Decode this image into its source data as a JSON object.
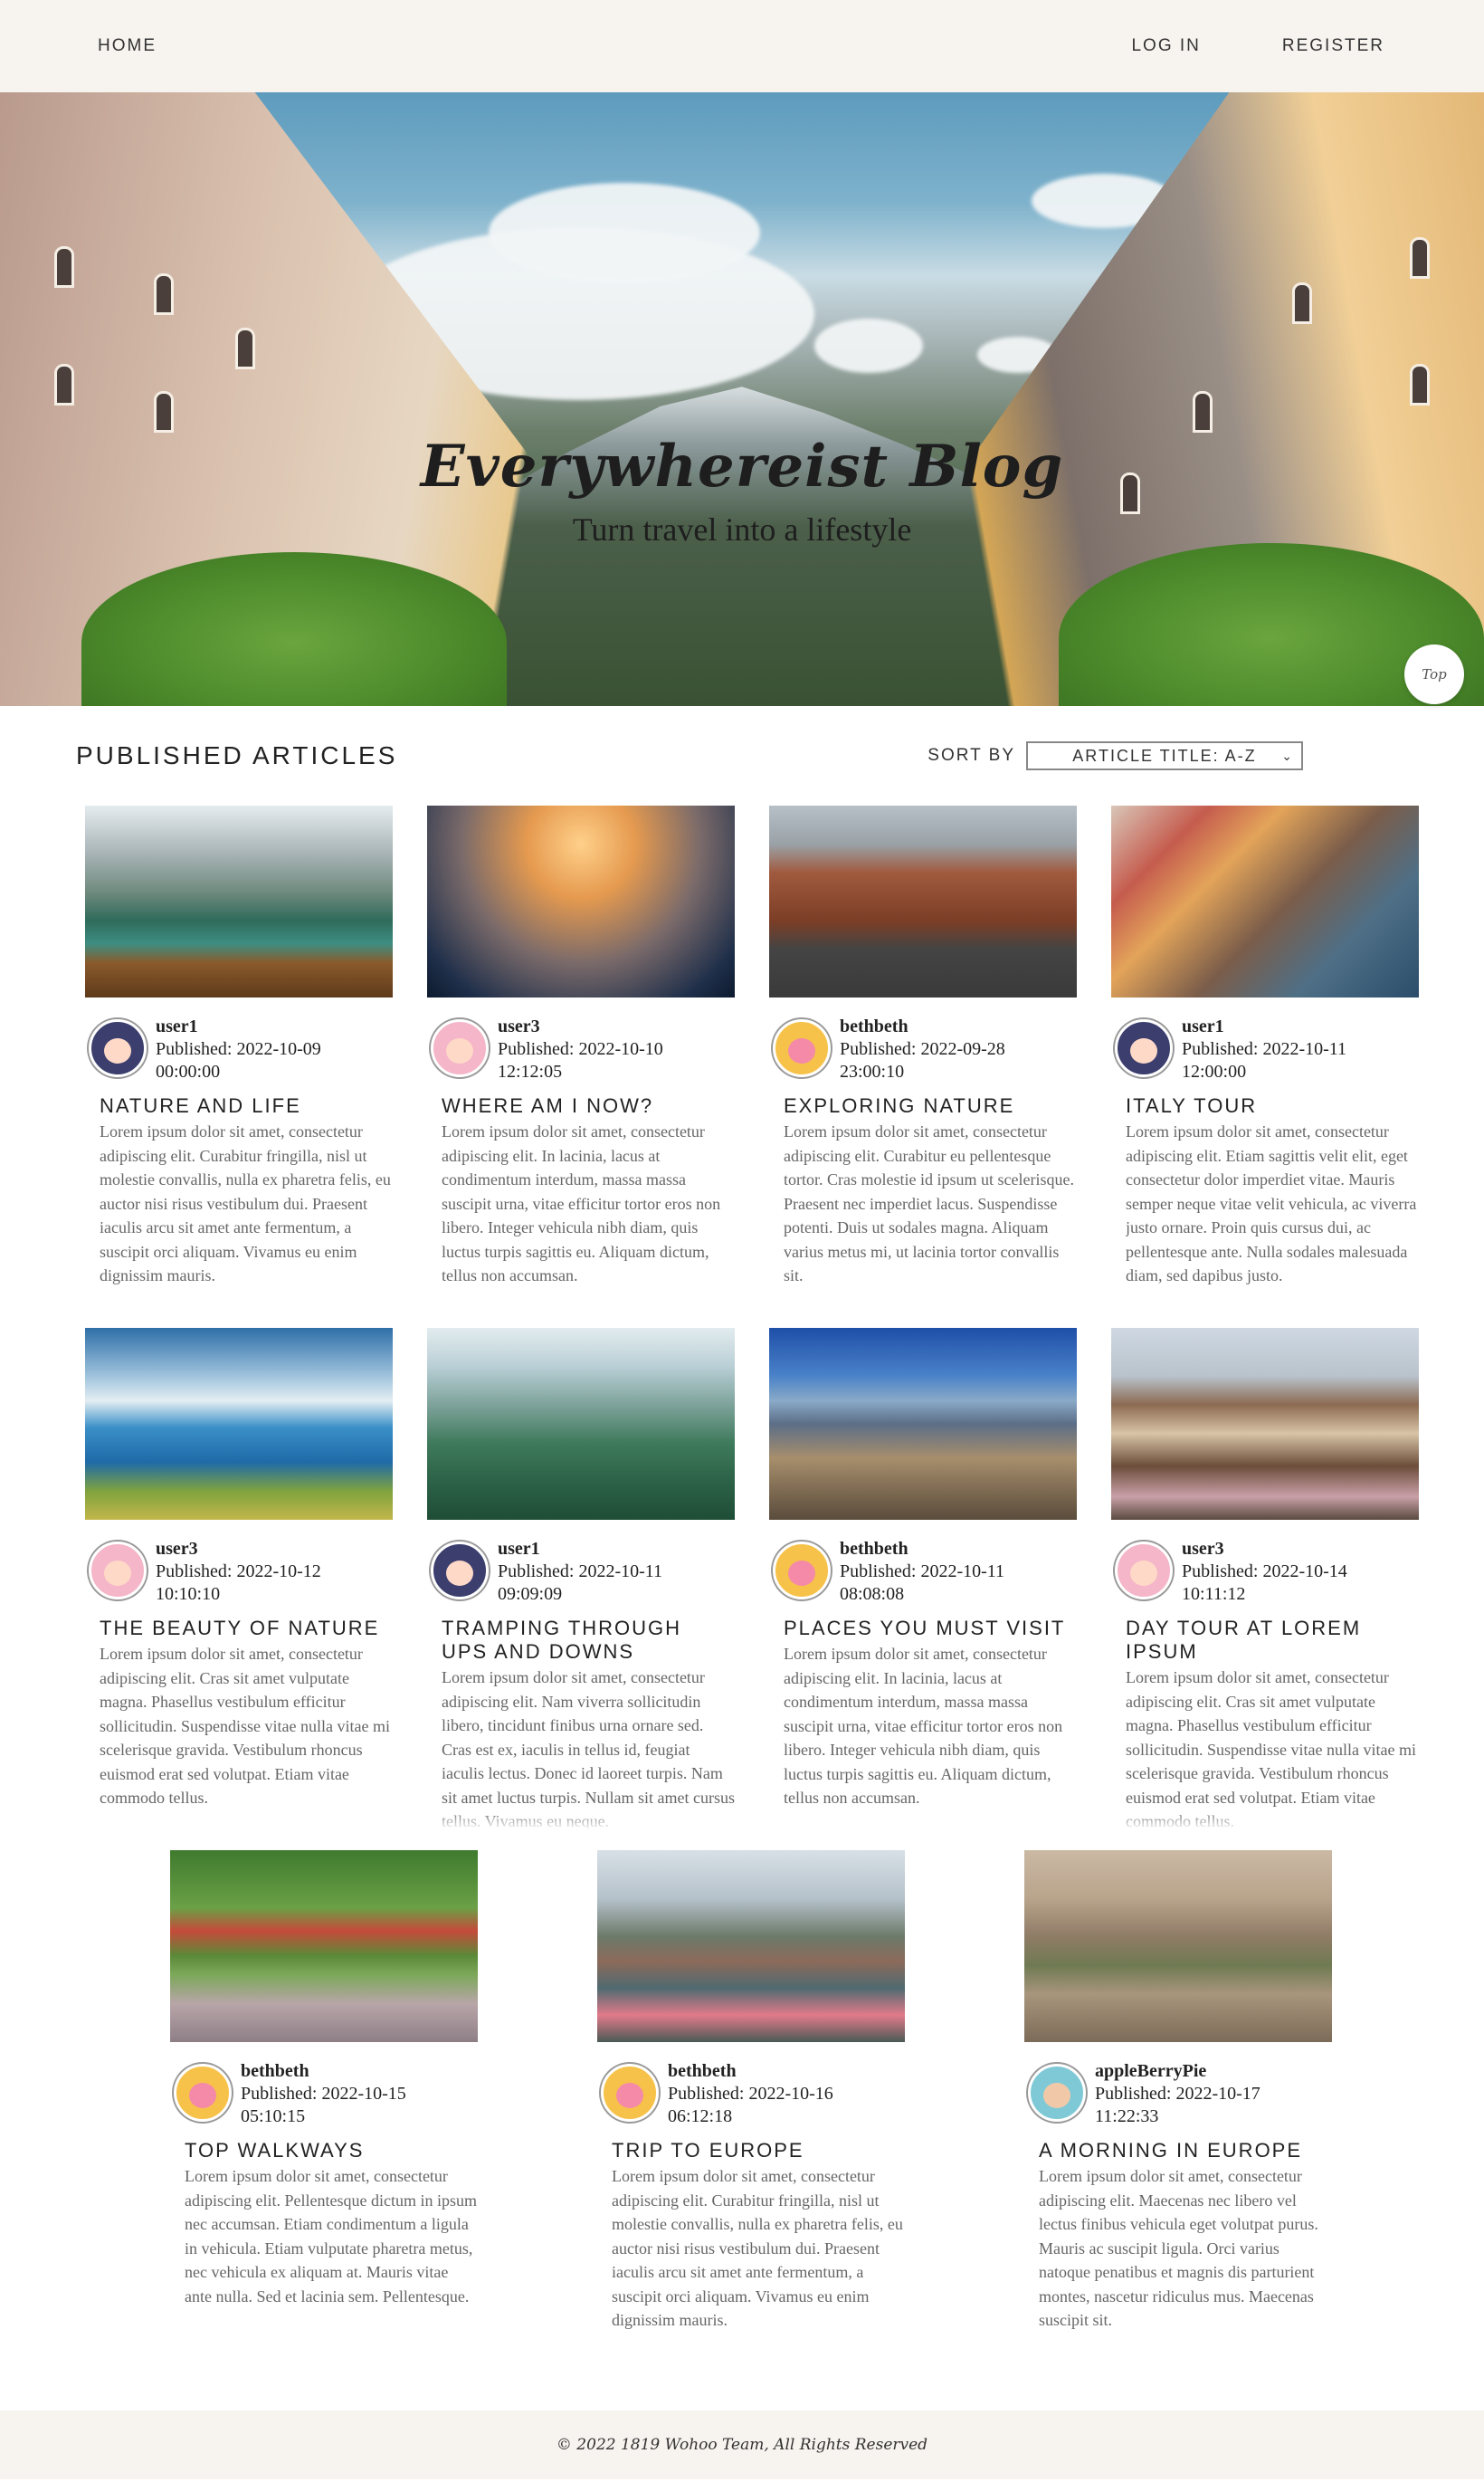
{
  "nav": {
    "home": "HOME",
    "login": "LOG IN",
    "register": "REGISTER"
  },
  "hero": {
    "title": "Everywhereist Blog",
    "subtitle": "Turn travel into a lifestyle",
    "top_button": "Top"
  },
  "articles": {
    "heading": "PUBLISHED ARTICLES",
    "sort_label": "SORT BY",
    "sort_value": "ARTICLE TITLE: A-Z",
    "items": [
      {
        "user": "user1",
        "published": "Published: 2022-10-09",
        "time": "00:00:00",
        "title": "NATURE AND LIFE",
        "excerpt": "Lorem ipsum dolor sit amet, consectetur adipiscing elit. Curabitur fringilla, nisl ut molestie convallis, nulla ex pharetra felis, eu auctor nisi risus vestibulum dui. Praesent iaculis arcu sit amet ante fermentum, a suscipit orci aliquam. Vivamus eu enim dignissim mauris."
      },
      {
        "user": "user3",
        "published": "Published: 2022-10-10",
        "time": "12:12:05",
        "title": "WHERE AM I NOW?",
        "excerpt": "Lorem ipsum dolor sit amet, consectetur adipiscing elit. In lacinia, lacus at condimentum interdum, massa massa suscipit urna, vitae efficitur tortor eros non libero. Integer vehicula nibh diam, quis luctus turpis sagittis eu. Aliquam dictum, tellus non accumsan."
      },
      {
        "user": "bethbeth",
        "published": "Published: 2022-09-28",
        "time": "23:00:10",
        "title": "EXPLORING NATURE",
        "excerpt": "Lorem ipsum dolor sit amet, consectetur adipiscing elit. Curabitur eu pellentesque tortor. Cras molestie id ipsum ut scelerisque. Praesent nec imperdiet lacus. Suspendisse potenti. Duis ut sodales magna. Aliquam varius metus mi, ut lacinia tortor convallis sit."
      },
      {
        "user": "user1",
        "published": "Published: 2022-10-11",
        "time": "12:00:00",
        "title": "ITALY TOUR",
        "excerpt": "Lorem ipsum dolor sit amet, consectetur adipiscing elit. Etiam sagittis velit elit, eget consectetur dolor imperdiet vitae. Mauris semper neque vitae velit vehicula, ac viverra justo ornare. Proin quis cursus dui, ac pellentesque ante. Nulla sodales malesuada diam, sed dapibus justo."
      },
      {
        "user": "user3",
        "published": "Published: 2022-10-12",
        "time": "10:10:10",
        "title": "THE BEAUTY OF NATURE",
        "excerpt": "Lorem ipsum dolor sit amet, consectetur adipiscing elit. Cras sit amet vulputate magna. Phasellus vestibulum efficitur sollicitudin. Suspendisse vitae nulla vitae mi scelerisque gravida. Vestibulum rhoncus euismod erat sed volutpat. Etiam vitae commodo tellus."
      },
      {
        "user": "user1",
        "published": "Published: 2022-10-11",
        "time": "09:09:09",
        "title": "TRAMPING THROUGH UPS AND DOWNS",
        "excerpt": "Lorem ipsum dolor sit amet, consectetur adipiscing elit. Nam viverra sollicitudin libero, tincidunt finibus urna ornare sed. Cras est ex, iaculis in tellus id, feugiat iaculis lectus. Donec id laoreet turpis. Nam sit amet luctus turpis. Nullam sit amet cursus tellus. Vivamus eu neque."
      },
      {
        "user": "bethbeth",
        "published": "Published: 2022-10-11",
        "time": "08:08:08",
        "title": "PLACES YOU MUST VISIT",
        "excerpt": "Lorem ipsum dolor sit amet, consectetur adipiscing elit. In lacinia, lacus at condimentum interdum, massa massa suscipit urna, vitae efficitur tortor eros non libero. Integer vehicula nibh diam, quis luctus turpis sagittis eu. Aliquam dictum, tellus non accumsan."
      },
      {
        "user": "user3",
        "published": "Published: 2022-10-14",
        "time": "10:11:12",
        "title": "DAY TOUR AT LOREM IPSUM",
        "excerpt": "Lorem ipsum dolor sit amet, consectetur adipiscing elit. Cras sit amet vulputate magna. Phasellus vestibulum efficitur sollicitudin. Suspendisse vitae nulla vitae mi scelerisque gravida. Vestibulum rhoncus euismod erat sed volutpat. Etiam vitae commodo tellus."
      },
      {
        "user": "bethbeth",
        "published": "Published: 2022-10-15",
        "time": "05:10:15",
        "title": "TOP WALKWAYS",
        "excerpt": "Lorem ipsum dolor sit amet, consectetur adipiscing elit. Pellentesque dictum in ipsum nec accumsan. Etiam condimentum a ligula in vehicula. Etiam vulputate pharetra metus, nec vehicula ex aliquam at. Mauris vitae ante nulla. Sed et lacinia sem. Pellentesque."
      },
      {
        "user": "bethbeth",
        "published": "Published: 2022-10-16",
        "time": "06:12:18",
        "title": "TRIP TO EUROPE",
        "excerpt": "Lorem ipsum dolor sit amet, consectetur adipiscing elit. Curabitur fringilla, nisl ut molestie convallis, nulla ex pharetra felis, eu auctor nisi risus vestibulum dui. Praesent iaculis arcu sit amet ante fermentum, a suscipit orci aliquam. Vivamus eu enim dignissim mauris."
      },
      {
        "user": "appleBerryPie",
        "published": "Published: 2022-10-17",
        "time": "11:22:33",
        "title": "A MORNING IN EUROPE",
        "excerpt": "Lorem ipsum dolor sit amet, consectetur adipiscing elit. Maecenas nec libero vel lectus finibus vehicula eget volutpat purus. Mauris ac suscipit ligula. Orci varius natoque penatibus et magnis dis parturient montes, nascetur ridiculus mus. Maecenas suscipit sit."
      }
    ]
  },
  "footer": {
    "copyright": "© 2022 1819 Wohoo Team, All Rights Reserved"
  }
}
